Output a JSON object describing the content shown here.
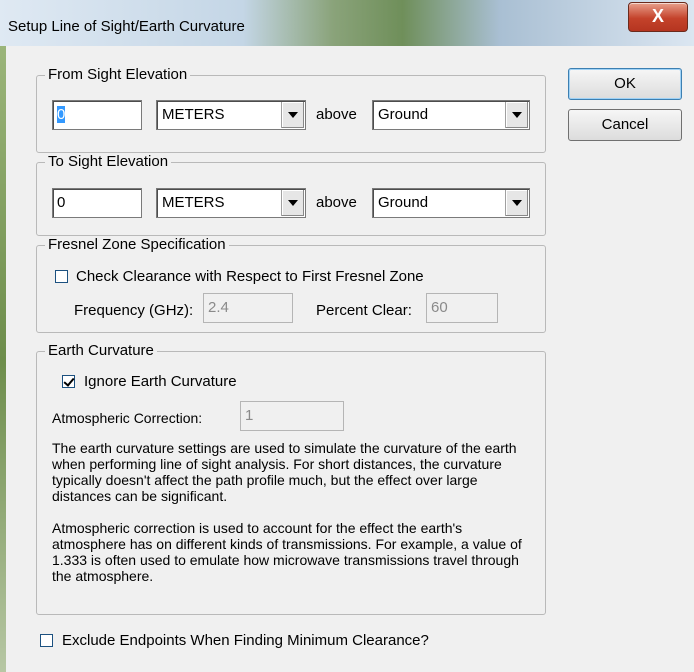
{
  "window": {
    "title": "Setup Line of Sight/Earth Curvature",
    "close_glyph": "X"
  },
  "buttons": {
    "ok": "OK",
    "cancel": "Cancel"
  },
  "from_sight": {
    "legend": "From Sight Elevation",
    "value": "0",
    "units": "METERS",
    "above_label": "above",
    "reference": "Ground"
  },
  "to_sight": {
    "legend": "To Sight Elevation",
    "value": "0",
    "units": "METERS",
    "above_label": "above",
    "reference": "Ground"
  },
  "fresnel": {
    "legend": "Fresnel Zone Specification",
    "checkbox_label": "Check Clearance with Respect to First Fresnel Zone",
    "checked": false,
    "frequency_label": "Frequency (GHz):",
    "frequency_value": "2.4",
    "percent_label": "Percent Clear:",
    "percent_value": "60"
  },
  "earth_curvature": {
    "legend": "Earth Curvature",
    "ignore_label": "Ignore Earth Curvature",
    "ignore_checked": true,
    "atmos_label": "Atmospheric Correction:",
    "atmos_value": "1",
    "description_1": "The earth curvature settings are used to simulate the curvature of the earth when performing line of sight analysis. For short distances, the curvature typically doesn't affect the path profile much, but the effect over large distances can be significant.",
    "description_2": "Atmospheric correction is used to account for the effect the earth's atmosphere has on different kinds of transmissions. For example, a value of 1.333 is often used to emulate how microwave transmissions travel through the atmosphere."
  },
  "exclude_endpoints": {
    "label": "Exclude Endpoints When Finding Minimum Clearance?",
    "checked": false
  },
  "icons": {
    "close": "close-icon",
    "dropdown": "chevron-down-icon",
    "checkmark": "checkmark-icon"
  }
}
